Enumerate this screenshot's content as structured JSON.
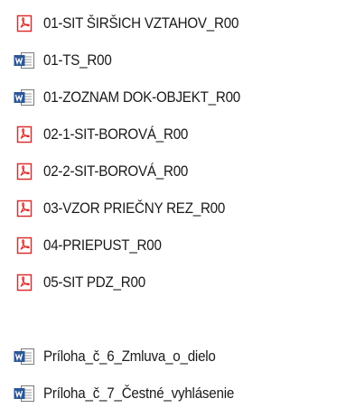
{
  "files": [
    {
      "name": "01-SIT ŠIRŠICH VZTAHOV_R00",
      "icon": "pdf-icon",
      "group": 1
    },
    {
      "name": "01-TS_R00",
      "icon": "word-document-icon",
      "group": 1
    },
    {
      "name": "01-ZOZNAM DOK-OBJEKT_R00",
      "icon": "word-document-icon",
      "group": 1
    },
    {
      "name": "02-1-SIT-BOROVÁ_R00",
      "icon": "pdf-icon",
      "group": 1
    },
    {
      "name": "02-2-SIT-BOROVÁ_R00",
      "icon": "pdf-icon",
      "group": 1
    },
    {
      "name": "03-VZOR PRIEČNY REZ_R00",
      "icon": "pdf-icon",
      "group": 1
    },
    {
      "name": "04-PRIEPUST_R00",
      "icon": "pdf-icon",
      "group": 1
    },
    {
      "name": "05-SIT PDZ_R00",
      "icon": "pdf-icon",
      "group": 1
    },
    {
      "name": "Príloha_č_6_Zmluva_o_dielo",
      "icon": "word-document-icon",
      "group": 2
    },
    {
      "name": "Príloha_č_7_Čestné_vyhlásenie",
      "icon": "word-document-icon",
      "group": 2
    }
  ],
  "colors": {
    "pdf_accent": "#d9302f",
    "word_accent": "#2b5797",
    "text": "#1a1a1a"
  }
}
